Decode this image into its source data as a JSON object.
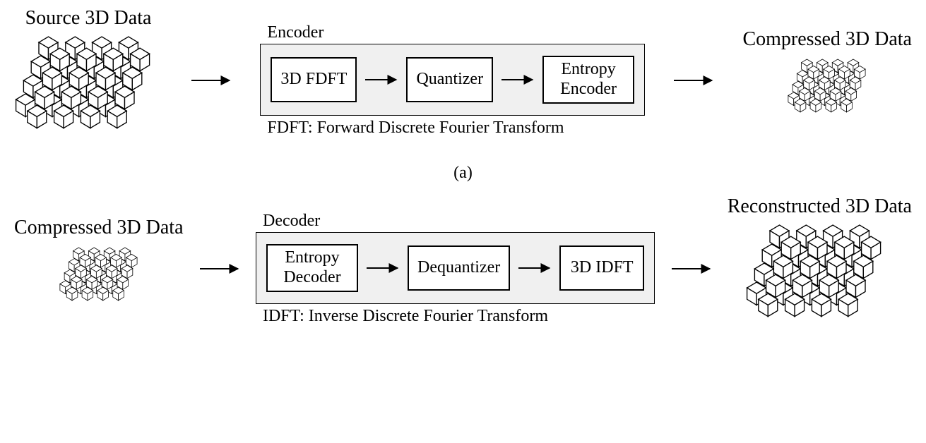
{
  "part_a": {
    "input_title": "Source 3D Data",
    "output_title": "Compressed 3D Data",
    "pipeline_label": "Encoder",
    "blocks": {
      "b1": "3D FDFT",
      "b2": "Quantizer",
      "b3": "Entropy\nEncoder"
    },
    "caption": "FDFT: Forward Discrete Fourier Transform",
    "sublabel": "(a)"
  },
  "part_b": {
    "input_title": "Compressed 3D Data",
    "output_title": "Reconstructed 3D Data",
    "pipeline_label": "Decoder",
    "blocks": {
      "b1": "Entropy\nDecoder",
      "b2": "Dequantizer",
      "b3": "3D IDFT"
    },
    "caption": "IDFT: Inverse Discrete Fourier Transform"
  }
}
